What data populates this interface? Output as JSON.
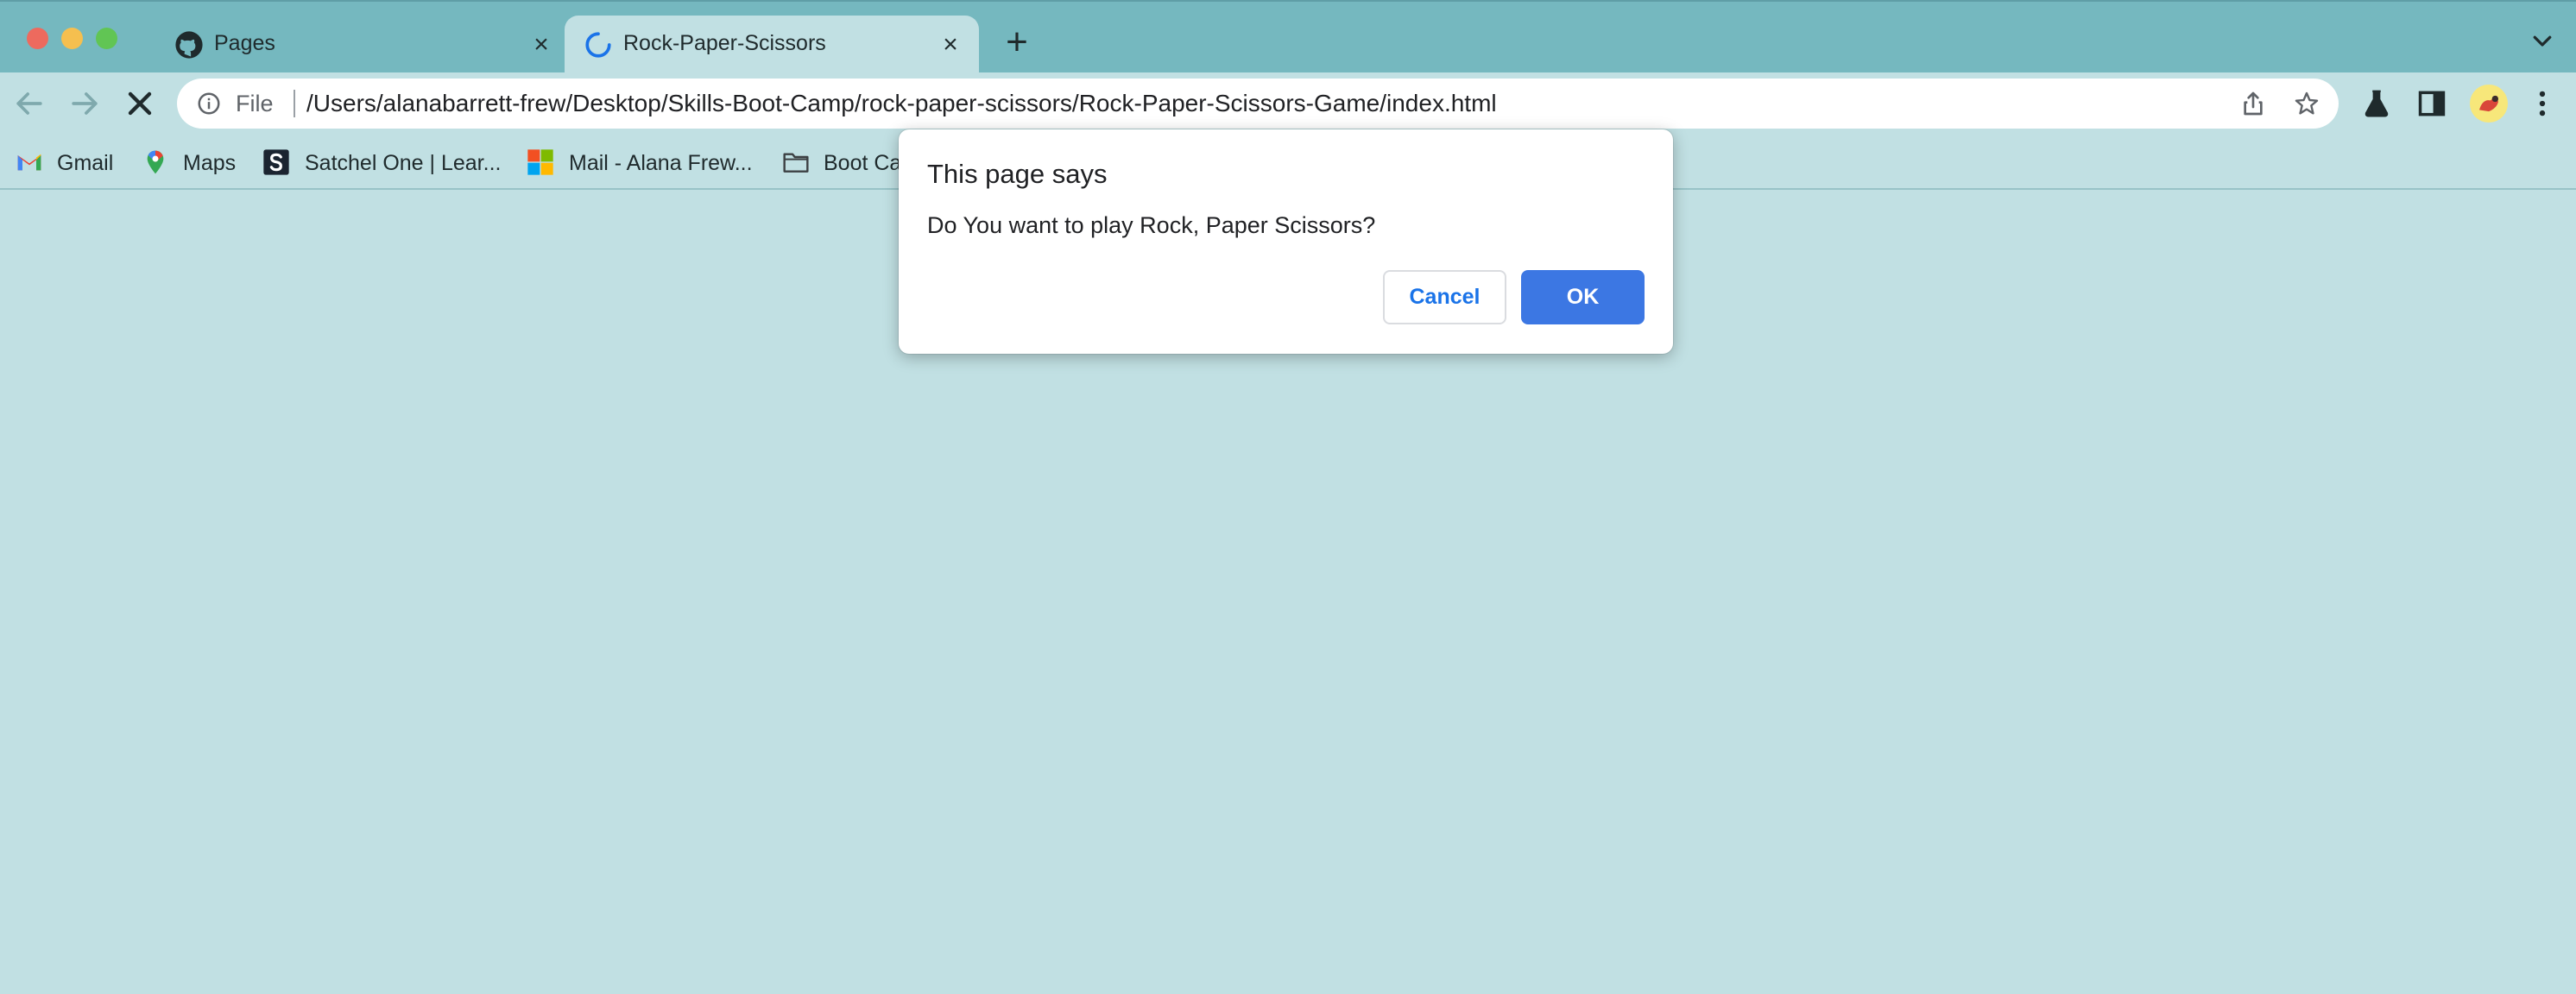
{
  "window": {
    "traffic_lights": [
      "close",
      "minimize",
      "zoom"
    ]
  },
  "tabs": [
    {
      "title": "Pages",
      "icon": "github-icon",
      "active": false
    },
    {
      "title": "Rock-Paper-Scissors",
      "icon": "loading-spinner-icon",
      "active": true
    }
  ],
  "toolbar": {
    "back_icon": "back-arrow-icon",
    "forward_icon": "forward-arrow-icon",
    "stop_icon": "stop-loading-icon"
  },
  "omnibox": {
    "scheme_label": "File",
    "url": "/Users/alanabarrett-frew/Desktop/Skills-Boot-Camp/rock-paper-scissors/Rock-Paper-Scissors-Game/index.html"
  },
  "bookmarks": [
    {
      "label": "Gmail",
      "icon": "gmail-icon"
    },
    {
      "label": "Maps",
      "icon": "maps-icon"
    },
    {
      "label": "Satchel One | Lear...",
      "icon": "satchel-one-icon"
    },
    {
      "label": "Mail - Alana Frew...",
      "icon": "microsoft-icon"
    },
    {
      "label": "Boot Ca",
      "icon": "folder-icon"
    }
  ],
  "dialog": {
    "title": "This page says",
    "message": "Do You want to play Rock, Paper Scissors?",
    "cancel_label": "Cancel",
    "ok_label": "OK"
  },
  "colors": {
    "page_background": "#c1e0e3",
    "tabstrip": "#75b8bf",
    "ok_button": "#3c77e3",
    "link_blue": "#1a73e8"
  }
}
